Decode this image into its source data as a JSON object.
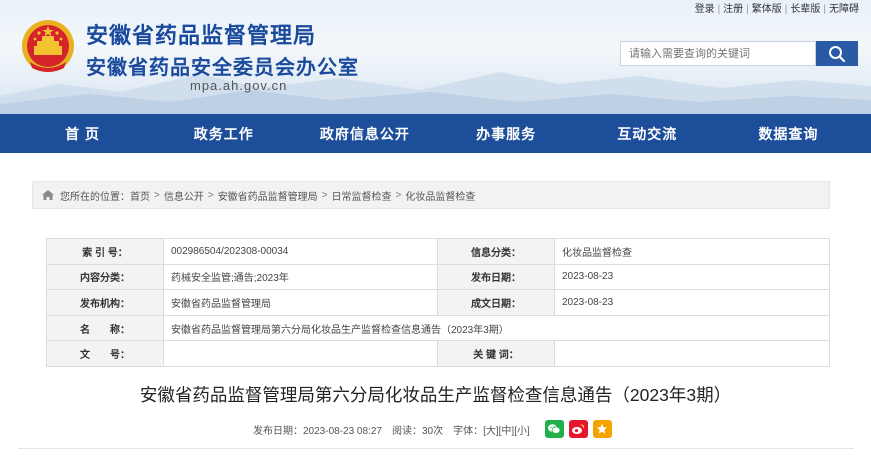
{
  "header": {
    "top_links": [
      "登录",
      "注册",
      "繁体版",
      "长辈版",
      "无障碍"
    ],
    "title_main": "安徽省药品监督管理局",
    "title_sub": "安徽省药品安全委员会办公室",
    "domain": "mpa.ah.gov.cn",
    "search_placeholder": "请输入需要查询的关键词"
  },
  "nav": [
    "首 页",
    "政务工作",
    "政府信息公开",
    "办事服务",
    "互动交流",
    "数据查询"
  ],
  "breadcrumb": {
    "prefix": "您所在的位置：",
    "items": [
      "首页",
      "信息公开",
      "安徽省药品监督管理局",
      "日常监督检查",
      "化妆品监督检查"
    ]
  },
  "info": {
    "index_label": "索 引 号：",
    "index_value": "002986504/202308-00034",
    "category_label": "信息分类：",
    "category_value": "化妆品监督检查",
    "content_label": "内容分类：",
    "content_value": "药械安全监管;通告;2023年",
    "publish_date_label": "发布日期：",
    "publish_date_value": "2023-08-23",
    "publisher_label": "发布机构：",
    "publisher_value": "安徽省药品监督管理局",
    "created_date_label": "成文日期：",
    "created_date_value": "2023-08-23",
    "name_label": "名　　称：",
    "name_value": "安徽省药品监督管理局第六分局化妆品生产监督检查信息通告（2023年3期）",
    "docno_label": "文　　号：",
    "docno_value": "",
    "keywords_label": "关 键 词：",
    "keywords_value": ""
  },
  "article": {
    "title": "安徽省药品监督管理局第六分局化妆品生产监督检查信息通告（2023年3期）",
    "publish_time": "发布日期：2023-08-23 08:27",
    "views": "阅读：30次",
    "font_label": "字体：",
    "font_large": "[大]",
    "font_medium": "[中]",
    "font_small": "[小]"
  },
  "colors": {
    "nav_bg": "#1d4e9a",
    "title_blue": "#1a4a9c",
    "wechat": "#22b04b",
    "weibo": "#e6162d",
    "qzone": "#f4a300"
  },
  "icons": [
    "national-emblem-icon",
    "search-icon",
    "home-icon",
    "wechat-icon",
    "weibo-icon",
    "qzone-icon"
  ]
}
